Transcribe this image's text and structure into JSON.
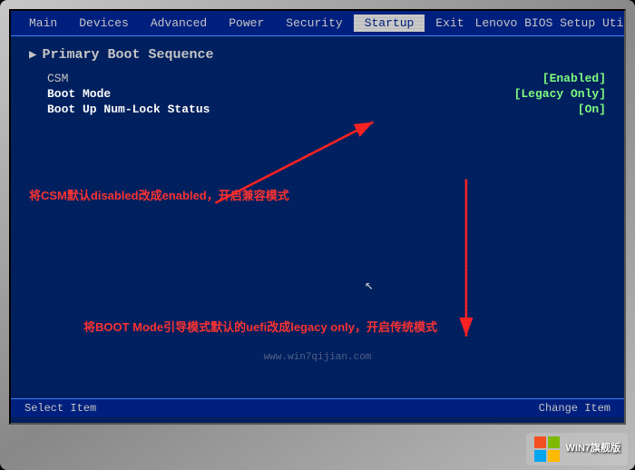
{
  "bios": {
    "title": "Lenovo BIOS Setup Utility",
    "menu_items": [
      {
        "label": "Main",
        "active": false
      },
      {
        "label": "Devices",
        "active": false
      },
      {
        "label": "Advanced",
        "active": false
      },
      {
        "label": "Power",
        "active": false
      },
      {
        "label": "Security",
        "active": false
      },
      {
        "label": "Startup",
        "active": true
      },
      {
        "label": "Exit",
        "active": false
      }
    ],
    "section": {
      "title": "Primary Boot Sequence",
      "rows": [
        {
          "label": "CSM",
          "value": "[Enabled]"
        },
        {
          "label": "Boot Mode",
          "value": "[Legacy Only]"
        },
        {
          "label": "Boot Up Num-Lock Status",
          "value": "[On]"
        }
      ]
    },
    "annotations": {
      "text1": "将CSM默认disabled改成enabled，开启兼容模式",
      "text2": "将BOOT Mode引导模式默认的uefi改成legacy only，开启传统模式"
    },
    "bottom_buttons": [
      {
        "label": "Select Item"
      },
      {
        "label": "Change Item"
      }
    ]
  },
  "watermark": {
    "url": "www.win7qijian.com"
  },
  "win7_badge": {
    "text": "WIN7旗舰版"
  }
}
